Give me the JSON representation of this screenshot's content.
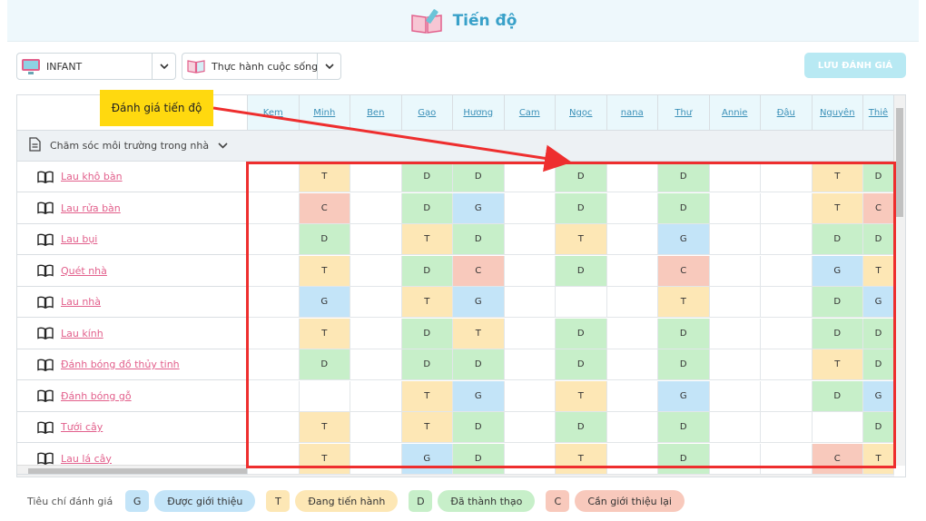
{
  "header": {
    "title": "Tiến độ"
  },
  "filters": {
    "class_value": "INFANT",
    "subject_value": "Thực hành cuộc sống"
  },
  "toolbar": {
    "save_label": "LƯU ĐÁNH GIÁ"
  },
  "callout": {
    "text": "Đánh giá tiến độ"
  },
  "students": [
    "Kem",
    "Minh",
    "Ben",
    "Gạo",
    "Hương",
    "Cam",
    "Ngọc",
    "nana",
    "Thư",
    "Annie",
    "Đậu",
    "Nguyên",
    "Thiê"
  ],
  "group": {
    "label": "Chăm sóc môi trường trong nhà"
  },
  "activities": [
    {
      "name": "Lau khô bàn",
      "marks": [
        "",
        "T",
        "",
        "D",
        "D",
        "",
        "D",
        "",
        "D",
        "",
        "",
        "T",
        "D"
      ]
    },
    {
      "name": "Lau rửa bàn",
      "marks": [
        "",
        "C",
        "",
        "D",
        "G",
        "",
        "D",
        "",
        "D",
        "",
        "",
        "T",
        "C"
      ]
    },
    {
      "name": "Lau bụi",
      "marks": [
        "",
        "D",
        "",
        "T",
        "D",
        "",
        "T",
        "",
        "G",
        "",
        "",
        "D",
        "D"
      ]
    },
    {
      "name": "Quét nhà",
      "marks": [
        "",
        "T",
        "",
        "D",
        "C",
        "",
        "D",
        "",
        "C",
        "",
        "",
        "G",
        "T"
      ]
    },
    {
      "name": "Lau nhà",
      "marks": [
        "",
        "G",
        "",
        "T",
        "G",
        "",
        "",
        "",
        "T",
        "",
        "",
        "D",
        "G"
      ]
    },
    {
      "name": "Lau kính",
      "marks": [
        "",
        "T",
        "",
        "D",
        "T",
        "",
        "D",
        "",
        "D",
        "",
        "",
        "D",
        "D"
      ]
    },
    {
      "name": "Đánh bóng đồ thủy tinh",
      "marks": [
        "",
        "D",
        "",
        "D",
        "D",
        "",
        "D",
        "",
        "D",
        "",
        "",
        "T",
        "D"
      ]
    },
    {
      "name": "Đánh bóng gỗ",
      "marks": [
        "",
        "",
        "",
        "T",
        "G",
        "",
        "T",
        "",
        "G",
        "",
        "",
        "D",
        "G"
      ]
    },
    {
      "name": "Tưới cây",
      "marks": [
        "",
        "T",
        "",
        "T",
        "D",
        "",
        "D",
        "",
        "D",
        "",
        "",
        "",
        "D"
      ]
    },
    {
      "name": "Lau lá cây",
      "marks": [
        "",
        "T",
        "",
        "G",
        "D",
        "",
        "T",
        "",
        "D",
        "",
        "",
        "C",
        "T"
      ]
    }
  ],
  "legend": {
    "title": "Tiêu chí đánh giá",
    "items": [
      {
        "code": "G",
        "label": "Được giới thiệu",
        "color": "#c3e4f8"
      },
      {
        "code": "T",
        "label": "Đang tiến hành",
        "color": "#fde7b5"
      },
      {
        "code": "D",
        "label": "Đã thành thạo",
        "color": "#c7efc9"
      },
      {
        "code": "C",
        "label": "Cần giới thiệu lại",
        "color": "#f8c9bc"
      }
    ]
  },
  "colors": {
    "G": "#c3e4f8",
    "T": "#fde7b5",
    "D": "#c7efc9",
    "C": "#f8c9bc",
    "accent": "#39a1c9",
    "highlight": "#ee2e2e"
  }
}
